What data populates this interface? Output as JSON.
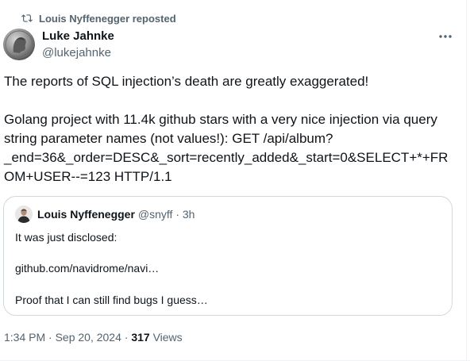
{
  "repost": {
    "text": "Louis Nyffenegger reposted",
    "icon": "retweet-icon"
  },
  "author": {
    "name": "Luke Jahnke",
    "handle": "@lukejahnke"
  },
  "more_icon": "more-horizontal-icon",
  "tweet": {
    "line1": "The reports of SQL injection’s death are greatly exaggerated!",
    "line2": "Golang project with 11.4k github stars with a very nice injection via query",
    "line3": "string parameter names (not values!): GET /api/album?",
    "line4": "_end=36&_order=DESC&_sort=recently_added&_start=0&SELECT+*+FR",
    "line5": "OM+USER--=123 HTTP/1.1"
  },
  "quote": {
    "name": "Louis Nyffenegger",
    "meta": "@snyff · 3h",
    "line1": "It was just disclosed:",
    "line2": "github.com/navidrome/navi…",
    "line3": "Proof that I can still find bugs I guess…"
  },
  "footer": {
    "timestamp": "1:34 PM · Sep 20, 2024 · ",
    "views_count": "317",
    "views_label": " Views"
  },
  "colors": {
    "text_primary": "#0f1419",
    "text_secondary": "#536471",
    "border": "#cfd9de"
  }
}
